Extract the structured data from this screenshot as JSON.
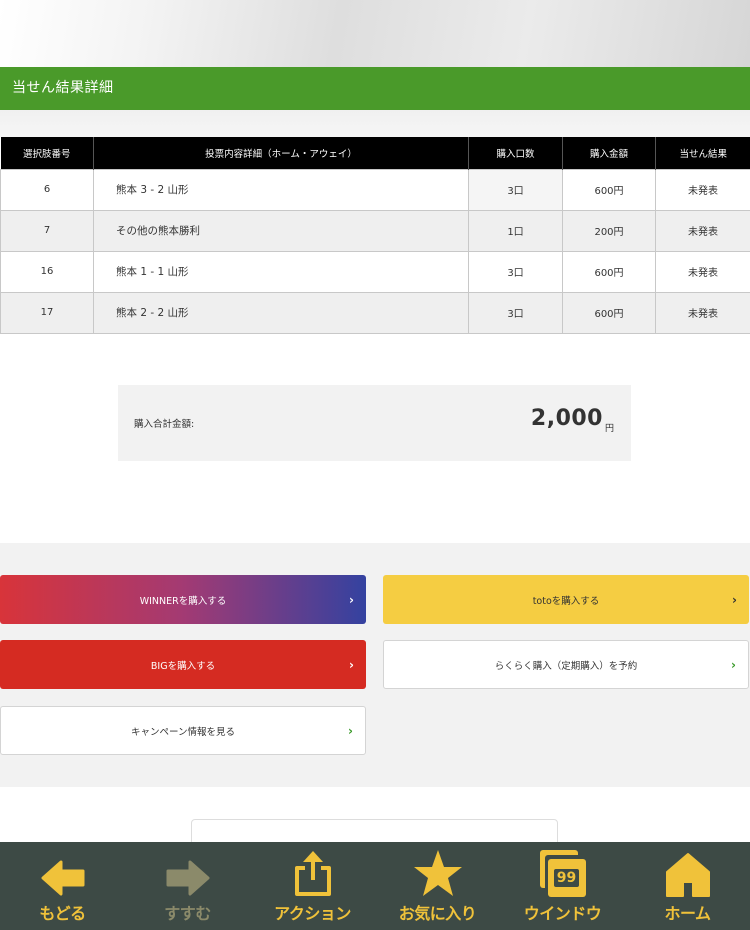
{
  "section_title": "当せん結果詳細",
  "table": {
    "headers": [
      "選択肢番号",
      "投票内容詳細（ホーム・アウェイ）",
      "購入口数",
      "購入金額",
      "当せん結果"
    ],
    "rows": [
      {
        "no": "6",
        "detail": "熊本 3 - 2 山形",
        "count": "3口",
        "amount": "600円",
        "result": "未発表"
      },
      {
        "no": "7",
        "detail": "その他の熊本勝利",
        "count": "1口",
        "amount": "200円",
        "result": "未発表"
      },
      {
        "no": "16",
        "detail": "熊本 1 - 1 山形",
        "count": "3口",
        "amount": "600円",
        "result": "未発表"
      },
      {
        "no": "17",
        "detail": "熊本 2 - 2 山形",
        "count": "3口",
        "amount": "600円",
        "result": "未発表"
      }
    ]
  },
  "total": {
    "label": "購入合計金額:",
    "amount": "2,000",
    "unit": "円"
  },
  "buttons": {
    "winner": "WINNERを購入する",
    "toto": "totoを購入する",
    "big": "BIGを購入する",
    "rakuraku": "らくらく購入（定期購入）を予約",
    "campaign": "キャンペーン情報を見る"
  },
  "toolbar": {
    "back": "もどる",
    "forward": "すすむ",
    "action": "アクション",
    "favorite": "お気に入り",
    "window": "ウインドウ",
    "window_count": "99",
    "home": "ホーム"
  },
  "colors": {
    "accent_green": "#4a9a2a",
    "toolbar_bg": "#3d4a45",
    "toolbar_icon": "#f0c23a",
    "big_red": "#d52b22",
    "toto_yellow": "#f5cd42"
  }
}
